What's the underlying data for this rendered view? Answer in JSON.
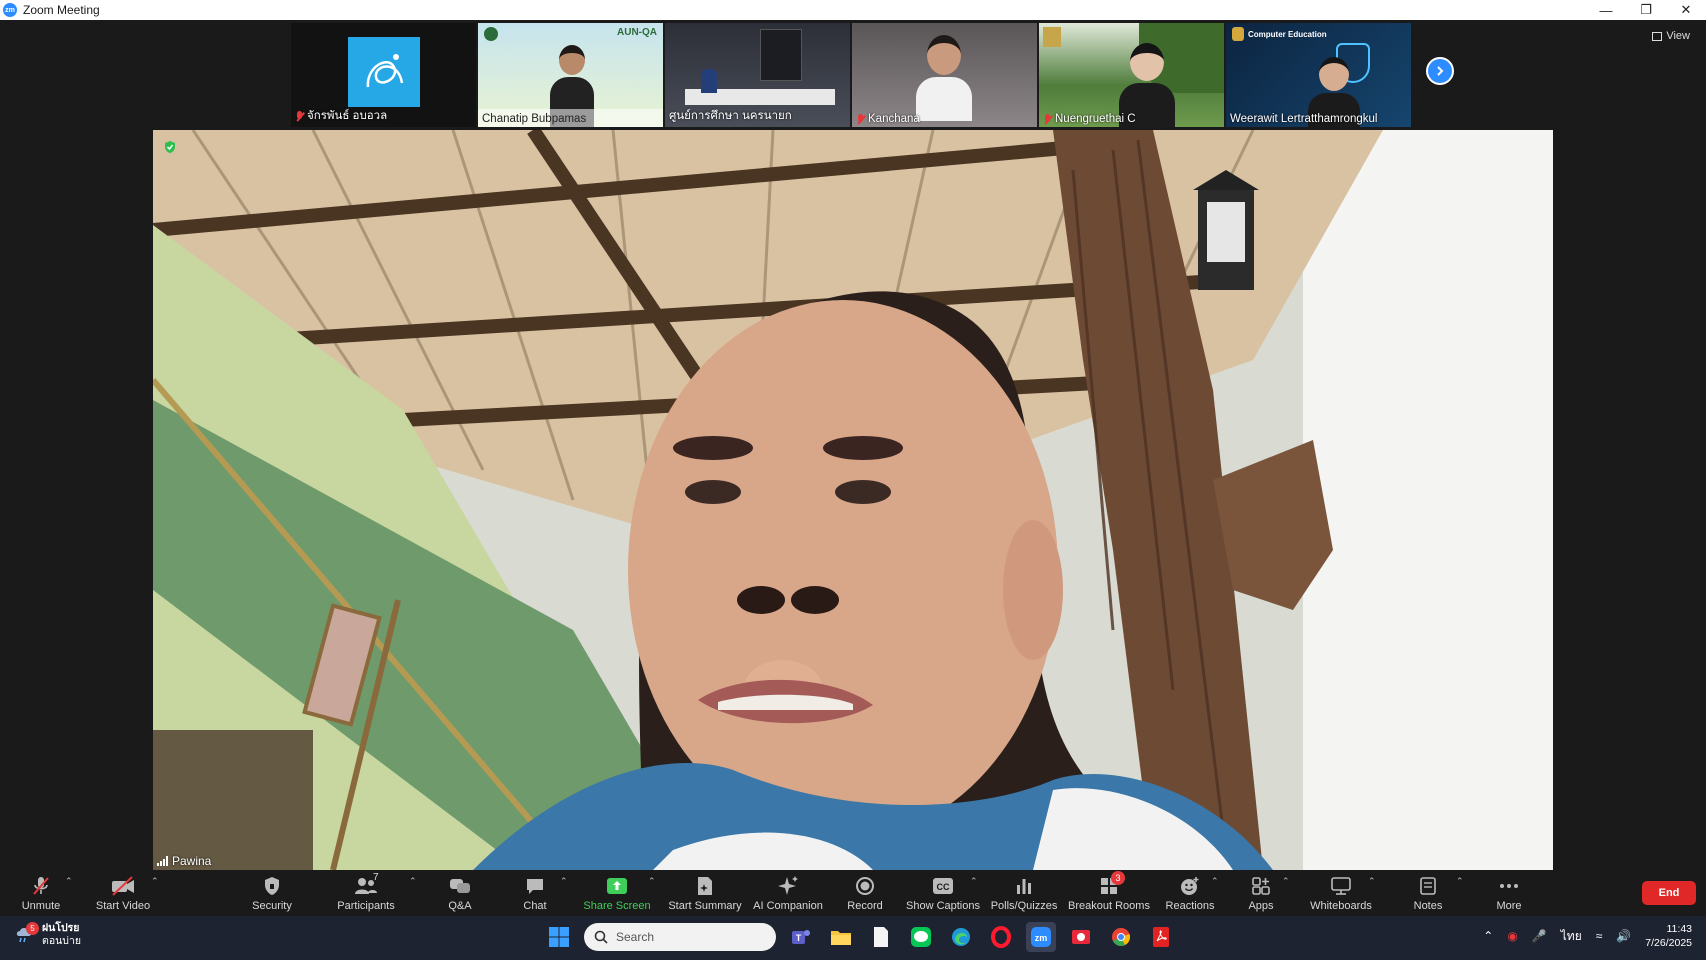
{
  "window": {
    "app_icon": "zm",
    "title": "Zoom Meeting"
  },
  "view_button": {
    "label": "View"
  },
  "participants_strip": [
    {
      "name": "จักรพันธ์ อบอวล",
      "muted": true,
      "bg": "#121212",
      "avatar_color": "#27a8e6"
    },
    {
      "name": "Chanatip Bubpamas",
      "muted": false,
      "bg": "#cfe8f0",
      "banner": "AUN-QA"
    },
    {
      "name": "ศูนย์การศึกษา นครนายก",
      "muted": false,
      "bg": "#3a3d47"
    },
    {
      "name": "Kanchana",
      "muted": true,
      "bg": "#6b6868"
    },
    {
      "name": "Nuengruethai C",
      "muted": true,
      "bg": "#5f8a49"
    },
    {
      "name": "Weerawit Lertratthamrongkul",
      "muted": false,
      "bg": "#0e2d4d",
      "banner": "Computer Education"
    }
  ],
  "main_video": {
    "speaker_name": "Pawina"
  },
  "toolbar": {
    "unmute": "Unmute",
    "start_video": "Start Video",
    "security": "Security",
    "participants": "Participants",
    "participants_count": "7",
    "qa": "Q&A",
    "chat": "Chat",
    "share_screen": "Share Screen",
    "start_summary": "Start Summary",
    "ai_companion": "AI Companion",
    "record": "Record",
    "show_captions": "Show Captions",
    "polls": "Polls/Quizzes",
    "breakout": "Breakout Rooms",
    "breakout_badge": "3",
    "reactions": "Reactions",
    "apps": "Apps",
    "whiteboards": "Whiteboards",
    "notes": "Notes",
    "more": "More",
    "end": "End"
  },
  "taskbar": {
    "weather_line1": "ฝนโปรย",
    "weather_line2": "ตอนบ่าย",
    "weather_badge": "5",
    "search_placeholder": "Search",
    "language": "ไทย",
    "time": "11:43",
    "date": "7/26/2025"
  },
  "colors": {
    "zoom_blue": "#2D8CFF",
    "end_red": "#e02828",
    "share_green": "#3fce5a"
  }
}
